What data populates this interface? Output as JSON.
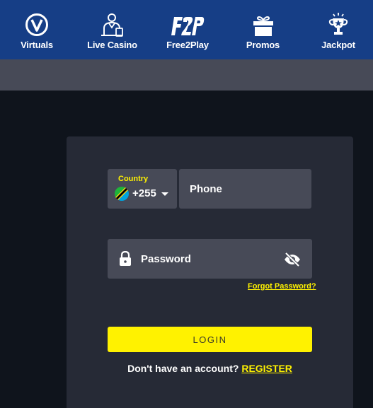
{
  "nav": {
    "items": [
      {
        "label": "Virtuals",
        "icon": "virtuals-v-icon"
      },
      {
        "label": "Live Casino",
        "icon": "dealer-icon"
      },
      {
        "label": "Free2Play",
        "icon": "f2p-logo-icon"
      },
      {
        "label": "Promos",
        "icon": "gift-icon"
      },
      {
        "label": "Jackpot",
        "icon": "trophy-icon"
      }
    ]
  },
  "login": {
    "country_label": "Country",
    "country_code": "+255",
    "country_flag": "tanzania-flag-icon",
    "phone_placeholder": "Phone",
    "password_placeholder": "Password",
    "forgot_password": "Forgot Password?",
    "login_button": "LOGIN",
    "no_account_text": "Don't have an account?",
    "register_link": "REGISTER"
  },
  "colors": {
    "nav_bg": "#163e86",
    "accent": "#fff200",
    "card_bg": "#262a36",
    "field_bg": "#474a57",
    "page_bg": "#0f141c"
  }
}
